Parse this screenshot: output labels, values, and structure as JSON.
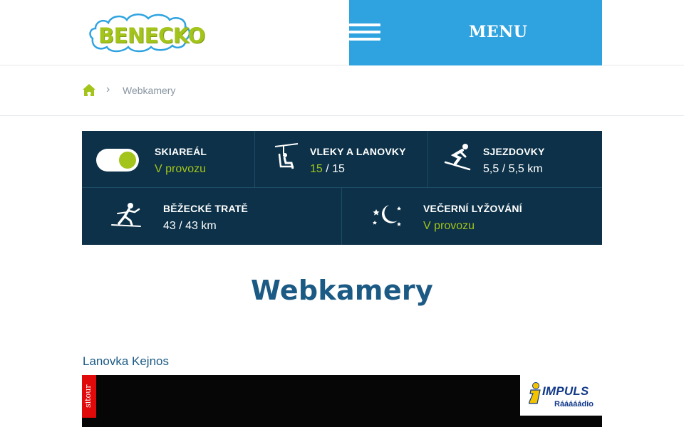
{
  "header": {
    "logo_text": "BENECKO",
    "menu_label": "MENU"
  },
  "breadcrumb": {
    "current": "Webkamery",
    "separator": "›"
  },
  "status": {
    "skiareal": {
      "title": "SKIAREÁL",
      "value": "V provozu"
    },
    "lifts": {
      "title": "VLEKY A LANOVKY",
      "open": "15",
      "total": " / 15"
    },
    "slopes": {
      "title": "SJEZDOVKY",
      "value": "5,5 / 5,5 km"
    },
    "crosscountry": {
      "title": "BĚŽECKÉ TRATĚ",
      "value": "43 / 43 km"
    },
    "evening": {
      "title": "VEČERNÍ LYŽOVÁNÍ",
      "value": "V provozu"
    }
  },
  "page": {
    "title": "Webkamery"
  },
  "webcam": {
    "label": "Lanovka Kejnos",
    "sitour": "sitour",
    "sponsor_brand": "IMPULS",
    "sponsor_sub": "Rááááádio"
  },
  "colors": {
    "brand_blue": "#2fa3e0",
    "panel_navy": "#0c3148",
    "accent_green": "#a3c41a",
    "title_blue": "#1b5a84"
  },
  "icons": [
    "hamburger-icon",
    "home-icon",
    "toggle-switch",
    "chairlift-icon",
    "downhill-skier-icon",
    "crosscountry-skier-icon",
    "moon-stars-icon",
    "impuls-logo-icon"
  ]
}
